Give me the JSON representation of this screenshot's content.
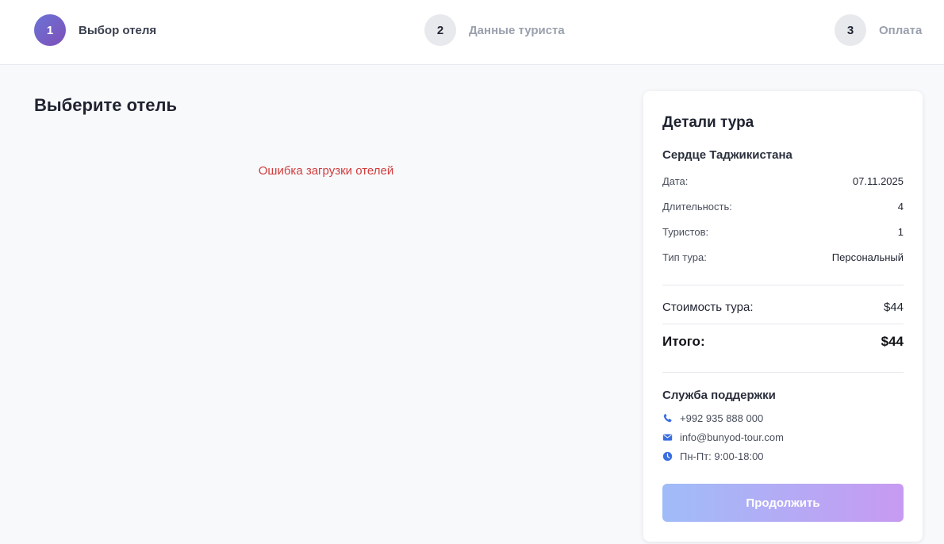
{
  "steps": [
    {
      "number": "1",
      "label": "Выбор отеля",
      "active": true
    },
    {
      "number": "2",
      "label": "Данные туриста",
      "active": false
    },
    {
      "number": "3",
      "label": "Оплата",
      "active": false
    }
  ],
  "main": {
    "title": "Выберите отель",
    "error": "Ошибка загрузки отелей"
  },
  "details": {
    "title": "Детали тура",
    "tour_name": "Сердце Таджикистана",
    "rows": [
      {
        "label": "Дата:",
        "value": "07.11.2025"
      },
      {
        "label": "Длительность:",
        "value": "4"
      },
      {
        "label": "Туристов:",
        "value": "1"
      },
      {
        "label": "Тип тура:",
        "value": "Персональный"
      }
    ],
    "cost_label": "Стоимость тура:",
    "cost_value": "$44",
    "total_label": "Итого:",
    "total_value": "$44"
  },
  "support": {
    "title": "Служба поддержки",
    "phone": "+992 935 888 000",
    "email": "info@bunyod-tour.com",
    "hours": "Пн-Пт: 9:00-18:00"
  },
  "continue_button": "Продолжить",
  "colors": {
    "accent_gradient_start": "#6a74d6",
    "accent_gradient_end": "#7f4fb8",
    "error": "#d23c3c",
    "icon": "#3b6fe0"
  }
}
